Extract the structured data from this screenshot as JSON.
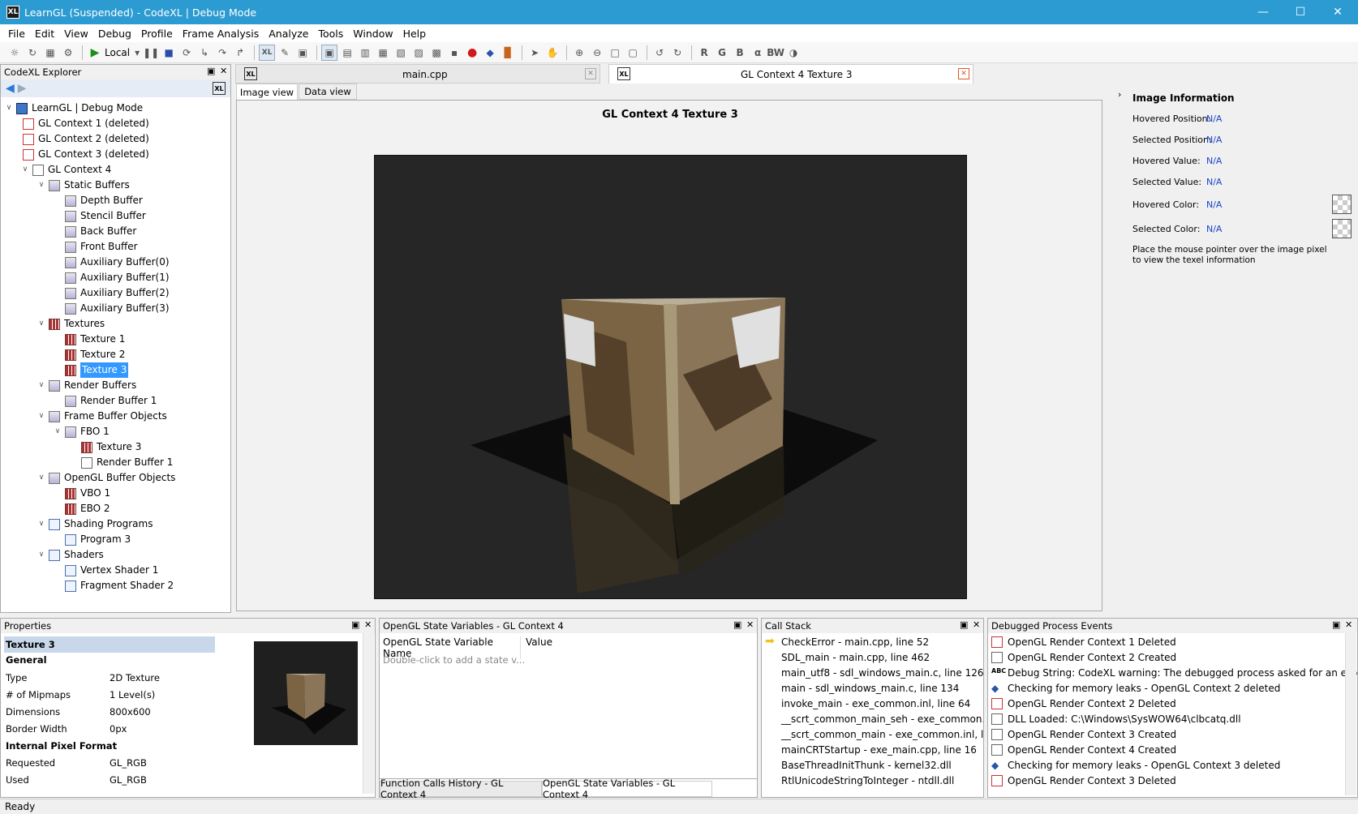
{
  "window": {
    "title": "LearnGL (Suspended) - CodeXL | Debug Mode",
    "app_icon": "XL"
  },
  "menu": [
    "File",
    "Edit",
    "View",
    "Debug",
    "Profile",
    "Frame Analysis",
    "Analyze",
    "Tools",
    "Window",
    "Help"
  ],
  "toolbar": {
    "run_target": "Local"
  },
  "explorer": {
    "title": "CodeXL Explorer",
    "root": "LearnGL | Debug Mode",
    "nodes": [
      "GL Context 1 (deleted)",
      "GL Context 2 (deleted)",
      "GL Context 3 (deleted)",
      "GL Context 4",
      "Static Buffers",
      "Depth Buffer",
      "Stencil Buffer",
      "Back Buffer",
      "Front Buffer",
      "Auxiliary Buffer(0)",
      "Auxiliary Buffer(1)",
      "Auxiliary Buffer(2)",
      "Auxiliary Buffer(3)",
      "Textures",
      "Texture 1",
      "Texture 2",
      "Texture 3",
      "Render Buffers",
      "Render Buffer 1",
      "Frame Buffer Objects",
      "FBO 1",
      "Texture 3",
      "Render Buffer 1",
      "OpenGL Buffer Objects",
      "VBO 1",
      "EBO 2",
      "Shading Programs",
      "Program 3",
      "Shaders",
      "Vertex Shader 1",
      "Fragment Shader 2"
    ]
  },
  "doc_tabs": {
    "tab1": "main.cpp",
    "tab2": "GL Context 4 Texture 3"
  },
  "view_tabs": {
    "image": "Image view",
    "data": "Data view"
  },
  "image_title": "GL Context 4 Texture 3",
  "image_info": {
    "heading": "Image Information",
    "rows": [
      {
        "label": "Hovered Position:",
        "value": "N/A"
      },
      {
        "label": "Selected Position:",
        "value": "N/A"
      },
      {
        "label": "Hovered Value:",
        "value": "N/A"
      },
      {
        "label": "Selected Value:",
        "value": "N/A"
      },
      {
        "label": "Hovered Color:",
        "value": "N/A"
      },
      {
        "label": "Selected Color:",
        "value": "N/A"
      }
    ],
    "hint_line1": "Place the mouse pointer over the image pixel",
    "hint_line2": "to view the texel information"
  },
  "properties": {
    "title": "Properties",
    "name": "Texture 3",
    "section_general": "General",
    "type_label": "Type",
    "type_value": "2D Texture",
    "mipmaps_label": "# of Mipmaps",
    "mipmaps_value": "1 Level(s)",
    "dimensions_label": "Dimensions",
    "dimensions_value": "800x600",
    "border_label": "Border Width",
    "border_value": "0px",
    "section_format": "Internal Pixel Format",
    "requested_label": "Requested",
    "requested_value": "GL_RGB",
    "used_label": "Used",
    "used_value": "GL_RGB"
  },
  "state_vars": {
    "title": "OpenGL State Variables - GL Context 4",
    "col_name": "OpenGL State Variable Name",
    "col_value": "Value",
    "placeholder": "Double-click to add a state v...",
    "tab1": "Function Calls History - GL Context 4",
    "tab2": "OpenGL State Variables - GL Context 4"
  },
  "call_stack": {
    "title": "Call Stack",
    "frames": [
      "CheckError - main.cpp, line 52",
      "SDL_main - main.cpp, line 462",
      "main_utf8 - sdl_windows_main.c, line 126",
      "main - sdl_windows_main.c, line 134",
      "invoke_main - exe_common.inl, line 64",
      "__scrt_common_main_seh - exe_common.inl...",
      "__scrt_common_main - exe_common.inl, lin...",
      "mainCRTStartup - exe_main.cpp, line 16",
      "BaseThreadInitThunk - kernel32.dll",
      "RtlUnicodeStringToInteger - ntdll.dll"
    ]
  },
  "events": {
    "title": "Debugged Process Events",
    "items": [
      "OpenGL Render Context 1 Deleted",
      "OpenGL Render Context 2 Created",
      "Debug String: CodeXL warning: The debugged process asked for an extensi...",
      "Checking for memory leaks - OpenGL Context 2 deleted",
      "OpenGL Render Context 2 Deleted",
      "DLL Loaded: C:\\Windows\\SysWOW64\\clbcatq.dll",
      "OpenGL Render Context 3 Created",
      "OpenGL Render Context 4 Created",
      "Checking for memory leaks - OpenGL Context 3 deleted",
      "OpenGL Render Context 3 Deleted"
    ]
  },
  "status": "Ready"
}
